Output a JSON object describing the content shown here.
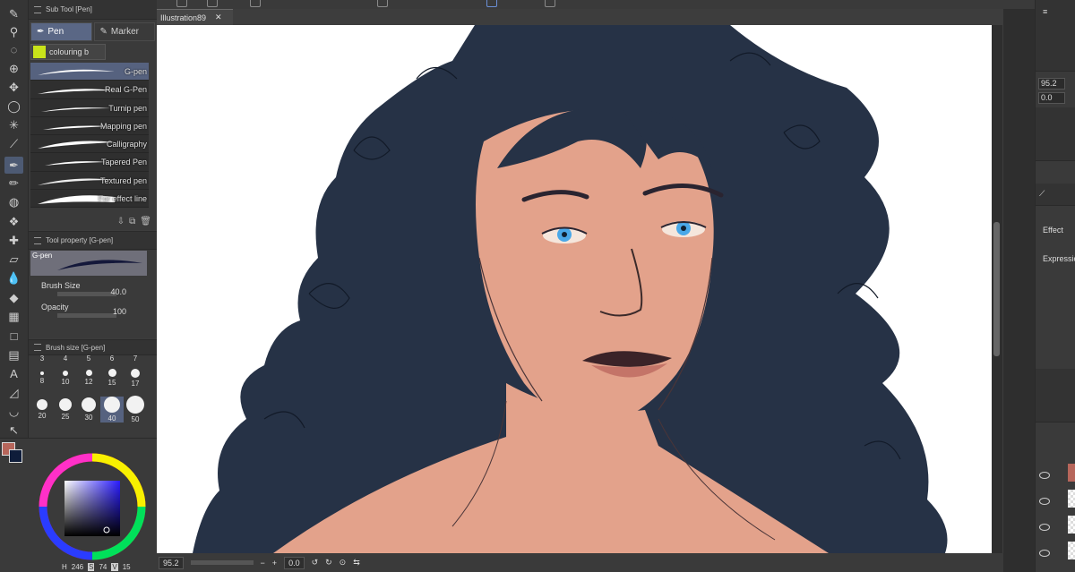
{
  "colors": {
    "ui_dark": "#353535",
    "ui_panel": "#3a3a3a",
    "selection": "#56627f",
    "skin": "#e3a28b",
    "hair": "#263246",
    "main_color": "#b7665b",
    "sub_color": "#0f1d3a"
  },
  "subtool": {
    "title": "Sub Tool [Pen]",
    "tabs": [
      "Pen",
      "Marker"
    ],
    "group_label": "colouring b",
    "brushes": [
      "G-pen",
      "Real G-Pen",
      "Turnip pen",
      "Mapping pen",
      "Calligraphy",
      "Tapered Pen",
      "Textured pen",
      "For effect line"
    ],
    "selected_brush": "G-pen"
  },
  "tool_property": {
    "title": "Tool property [G-pen]",
    "preview_label": "G-pen",
    "brush_size_label": "Brush Size",
    "brush_size_value": "40.0",
    "opacity_label": "Opacity",
    "opacity_value": "100"
  },
  "brush_size_panel": {
    "title": "Brush size [G-pen]",
    "sizes": [
      "3",
      "4",
      "5",
      "6",
      "7",
      "8",
      "10",
      "12",
      "15",
      "17",
      "20",
      "25",
      "30",
      "40",
      "50"
    ],
    "selected": "40"
  },
  "color_panel": {
    "h_label": "H",
    "h_value": "246",
    "s_label": "S",
    "s_value": "74",
    "v_label": "V",
    "v_value": "15"
  },
  "document": {
    "tab_title": "Illustration89",
    "close_glyph": "✕"
  },
  "status_bar": {
    "zoom": "95.2",
    "rotation": "0.0"
  },
  "right_panel": {
    "zoom_value": "95.2",
    "rotate_value": "0.0",
    "effect_label": "Effect",
    "expression_label": "Expressio"
  }
}
